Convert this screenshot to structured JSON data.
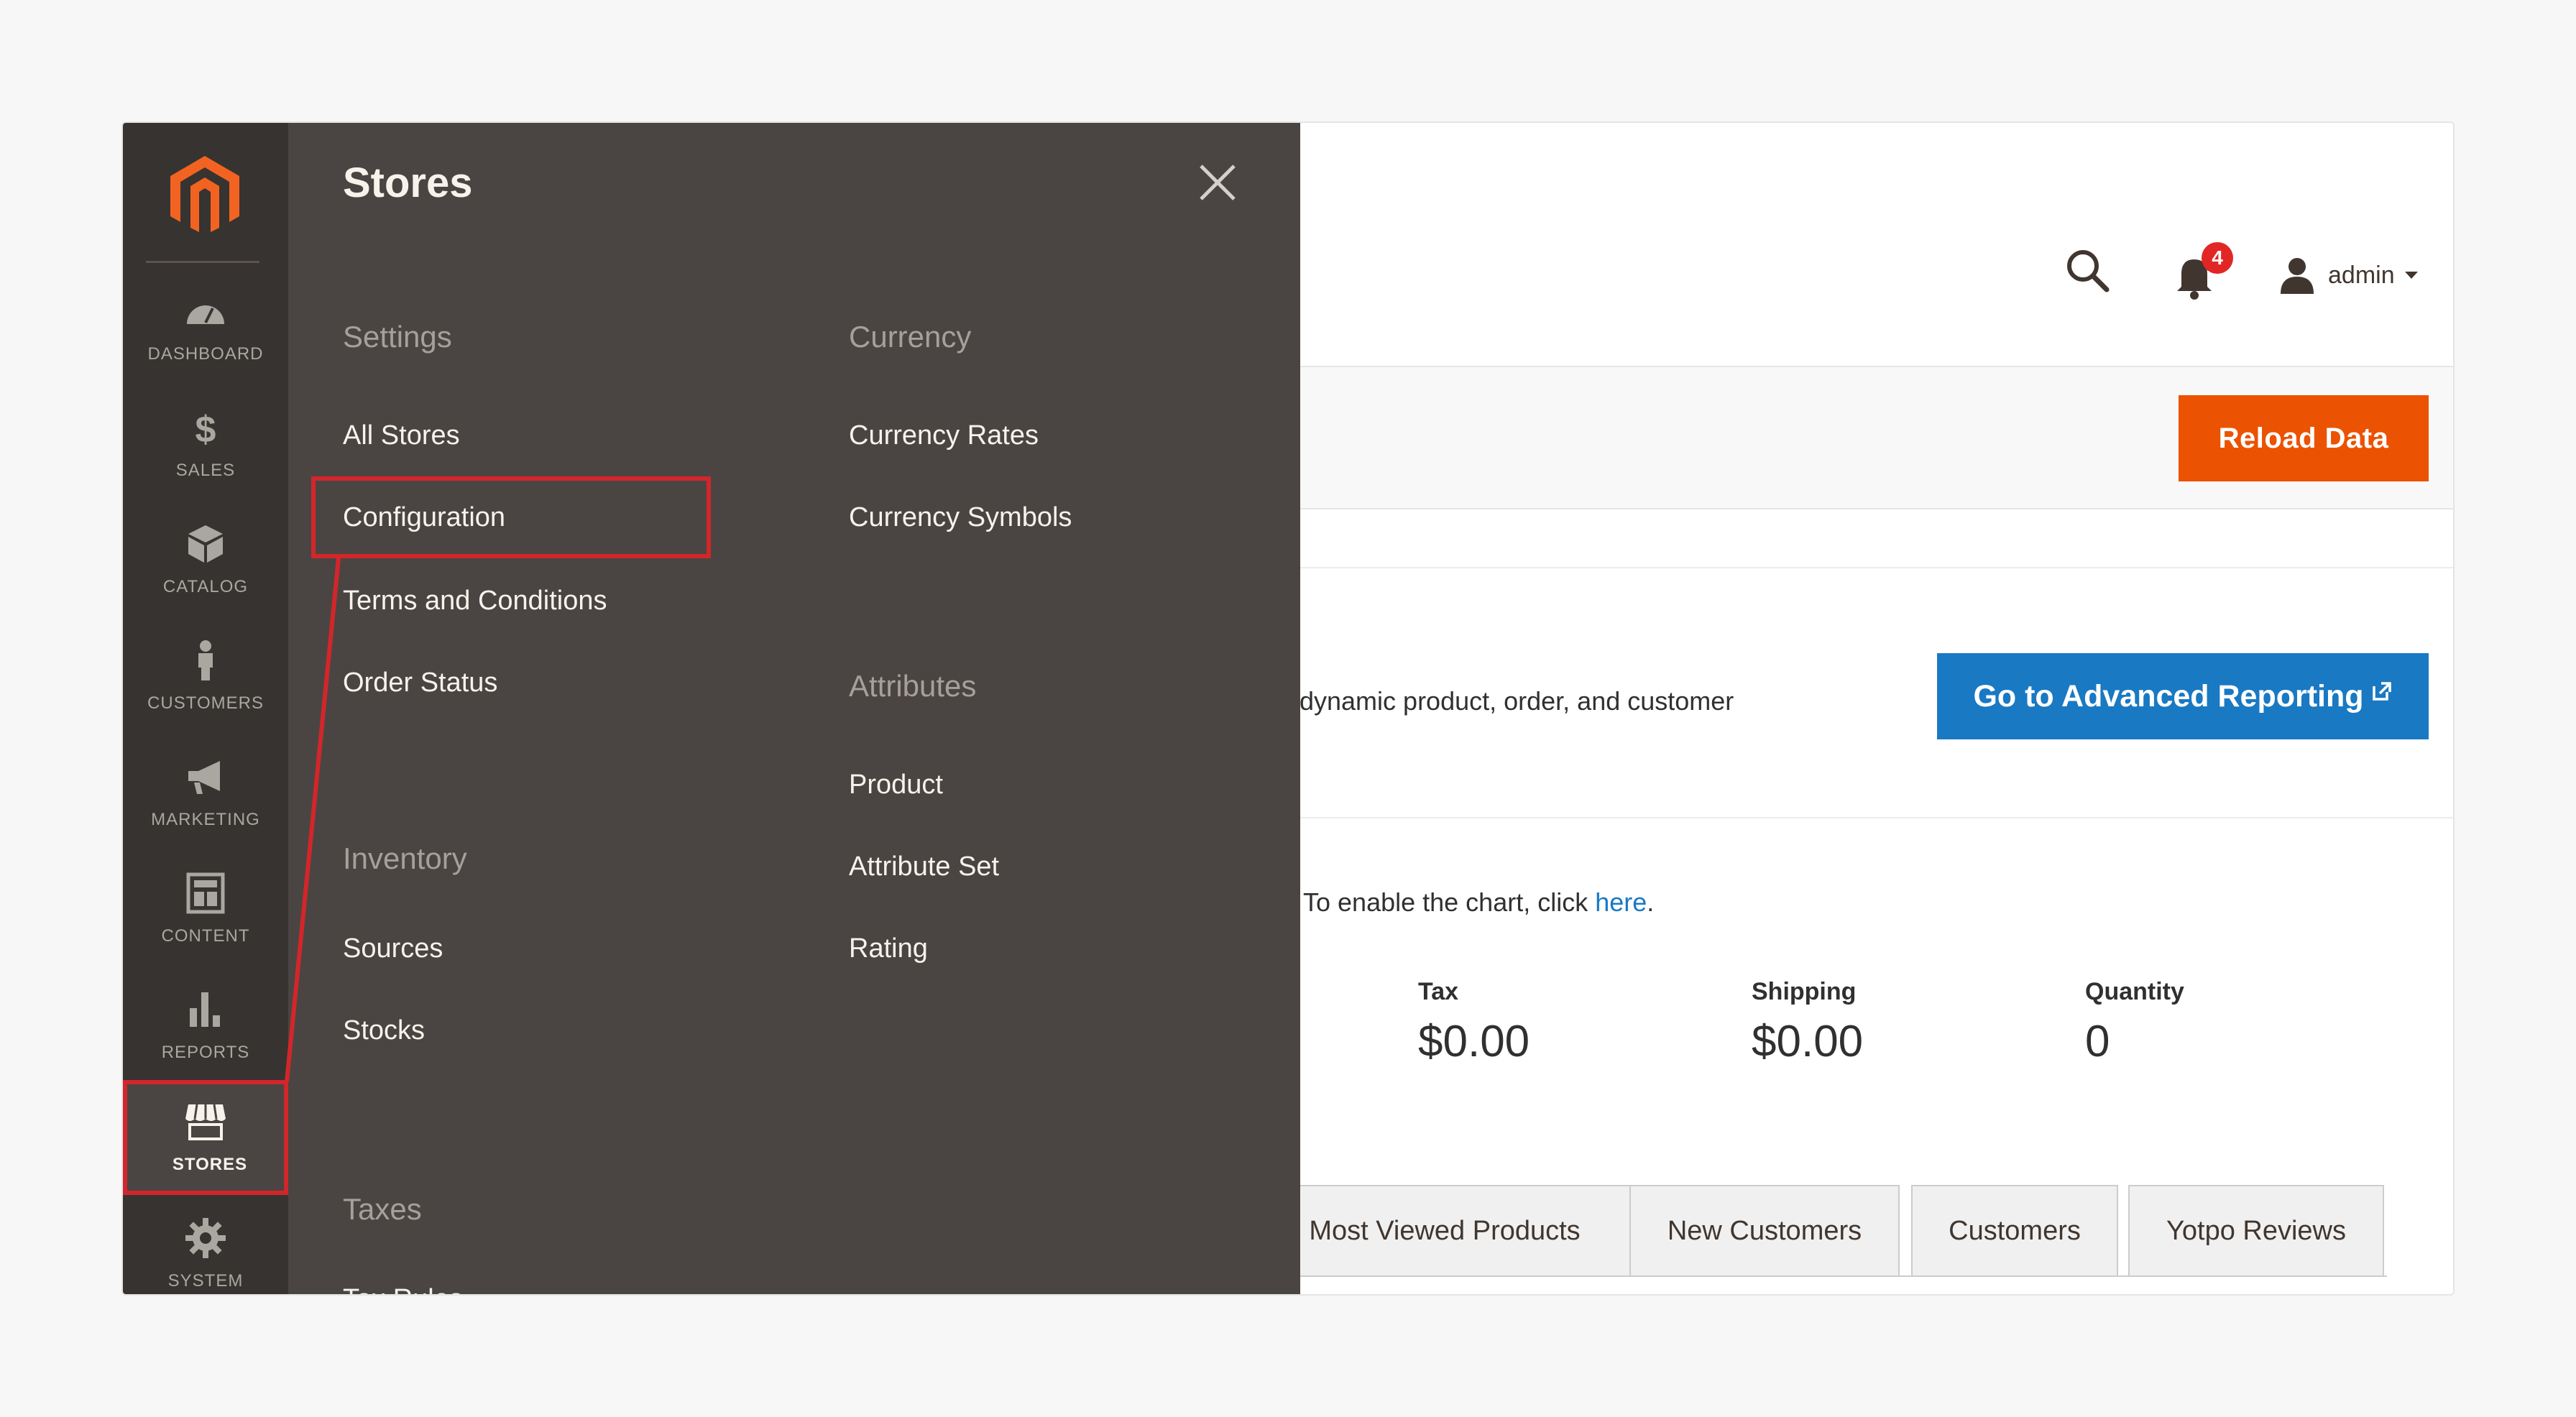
{
  "header": {
    "notifications_count": "4",
    "user_name": "admin"
  },
  "actions": {
    "reload_label": "Reload Data"
  },
  "dashboard": {
    "intro_text": "r dynamic product, order, and customer",
    "advanced_reporting_label": "Go to Advanced Reporting",
    "chart_note": "To enable the chart, click",
    "chart_link": "here",
    "chart_note_end": ".",
    "stats": [
      {
        "label": "Tax",
        "value": "$0.00"
      },
      {
        "label": "Shipping",
        "value": "$0.00"
      },
      {
        "label": "Quantity",
        "value": "0"
      }
    ],
    "tabs": [
      {
        "label": "Most Viewed Products"
      },
      {
        "label": "New Customers"
      },
      {
        "label": "Customers"
      },
      {
        "label": "Yotpo Reviews"
      }
    ]
  },
  "sidebar": {
    "items": [
      {
        "label": "DASHBOARD",
        "icon": "dashboard-icon"
      },
      {
        "label": "SALES",
        "icon": "dollar-icon"
      },
      {
        "label": "CATALOG",
        "icon": "box-icon"
      },
      {
        "label": "CUSTOMERS",
        "icon": "person-icon"
      },
      {
        "label": "MARKETING",
        "icon": "megaphone-icon"
      },
      {
        "label": "CONTENT",
        "icon": "layout-icon"
      },
      {
        "label": "REPORTS",
        "icon": "bar-chart-icon"
      },
      {
        "label": "STORES",
        "icon": "storefront-icon",
        "active": true
      },
      {
        "label": "SYSTEM",
        "icon": "gear-icon"
      }
    ]
  },
  "flyout": {
    "title": "Stores",
    "settings": {
      "heading": "Settings",
      "items": [
        "All Stores",
        "Configuration",
        "Terms and Conditions",
        "Order Status"
      ]
    },
    "inventory": {
      "heading": "Inventory",
      "items": [
        "Sources",
        "Stocks"
      ]
    },
    "taxes": {
      "heading": "Taxes",
      "items": [
        "Tax Rules"
      ]
    },
    "currency": {
      "heading": "Currency",
      "items": [
        "Currency Rates",
        "Currency Symbols"
      ]
    },
    "attributes": {
      "heading": "Attributes",
      "items": [
        "Product",
        "Attribute Set",
        "Rating"
      ]
    }
  },
  "colors": {
    "accent_orange": "#eb5202",
    "accent_blue": "#1979c3",
    "highlight_red": "#d3262a",
    "nav_dark": "#373330",
    "flyout_bg": "#4a4542"
  }
}
